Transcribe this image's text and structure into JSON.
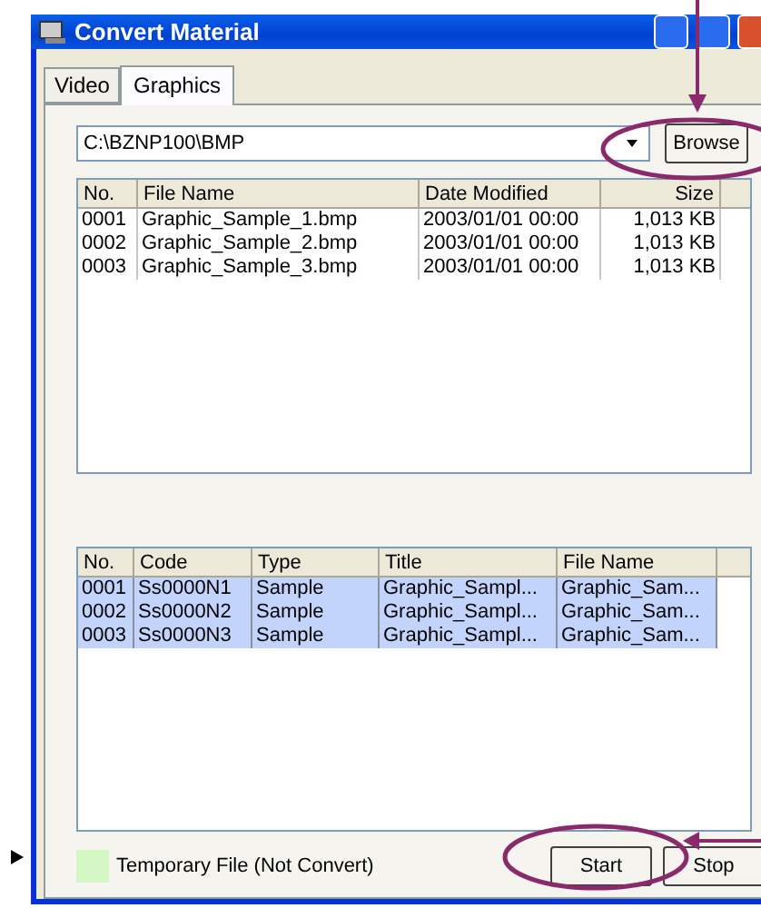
{
  "window": {
    "title": "Convert Material"
  },
  "tabs": [
    {
      "label": "Video",
      "selected": false
    },
    {
      "label": "Graphics",
      "selected": true
    }
  ],
  "path_combo": {
    "value": "C:\\BZNP100\\BMP"
  },
  "browse_button": "Browse",
  "files_table": {
    "columns": [
      "No.",
      "File Name",
      "Date Modified",
      "Size"
    ],
    "rows": [
      {
        "cells": [
          "0001",
          "Graphic_Sample_1.bmp",
          "2003/01/01 00:00",
          "1,013 KB"
        ],
        "selected": false
      },
      {
        "cells": [
          "0002",
          "Graphic_Sample_2.bmp",
          "2003/01/01 00:00",
          "1,013 KB"
        ],
        "selected": false
      },
      {
        "cells": [
          "0003",
          "Graphic_Sample_3.bmp",
          "2003/01/01 00:00",
          "1,013 KB"
        ],
        "selected": false
      }
    ]
  },
  "materials_table": {
    "columns": [
      "No.",
      "Code",
      "Type",
      "Title",
      "File Name"
    ],
    "rows": [
      {
        "cells": [
          "0001",
          "Ss0000N1",
          "Sample",
          "Graphic_Sampl...",
          "Graphic_Sam..."
        ],
        "selected": true
      },
      {
        "cells": [
          "0002",
          "Ss0000N2",
          "Sample",
          "Graphic_Sampl...",
          "Graphic_Sam..."
        ],
        "selected": true
      },
      {
        "cells": [
          "0003",
          "Ss0000N3",
          "Sample",
          "Graphic_Sampl...",
          "Graphic_Sam..."
        ],
        "selected": true
      }
    ]
  },
  "legend": {
    "label": "Temporary File (Not Convert)",
    "color": "#d4f7c4"
  },
  "buttons": [
    "Start",
    "Stop"
  ]
}
